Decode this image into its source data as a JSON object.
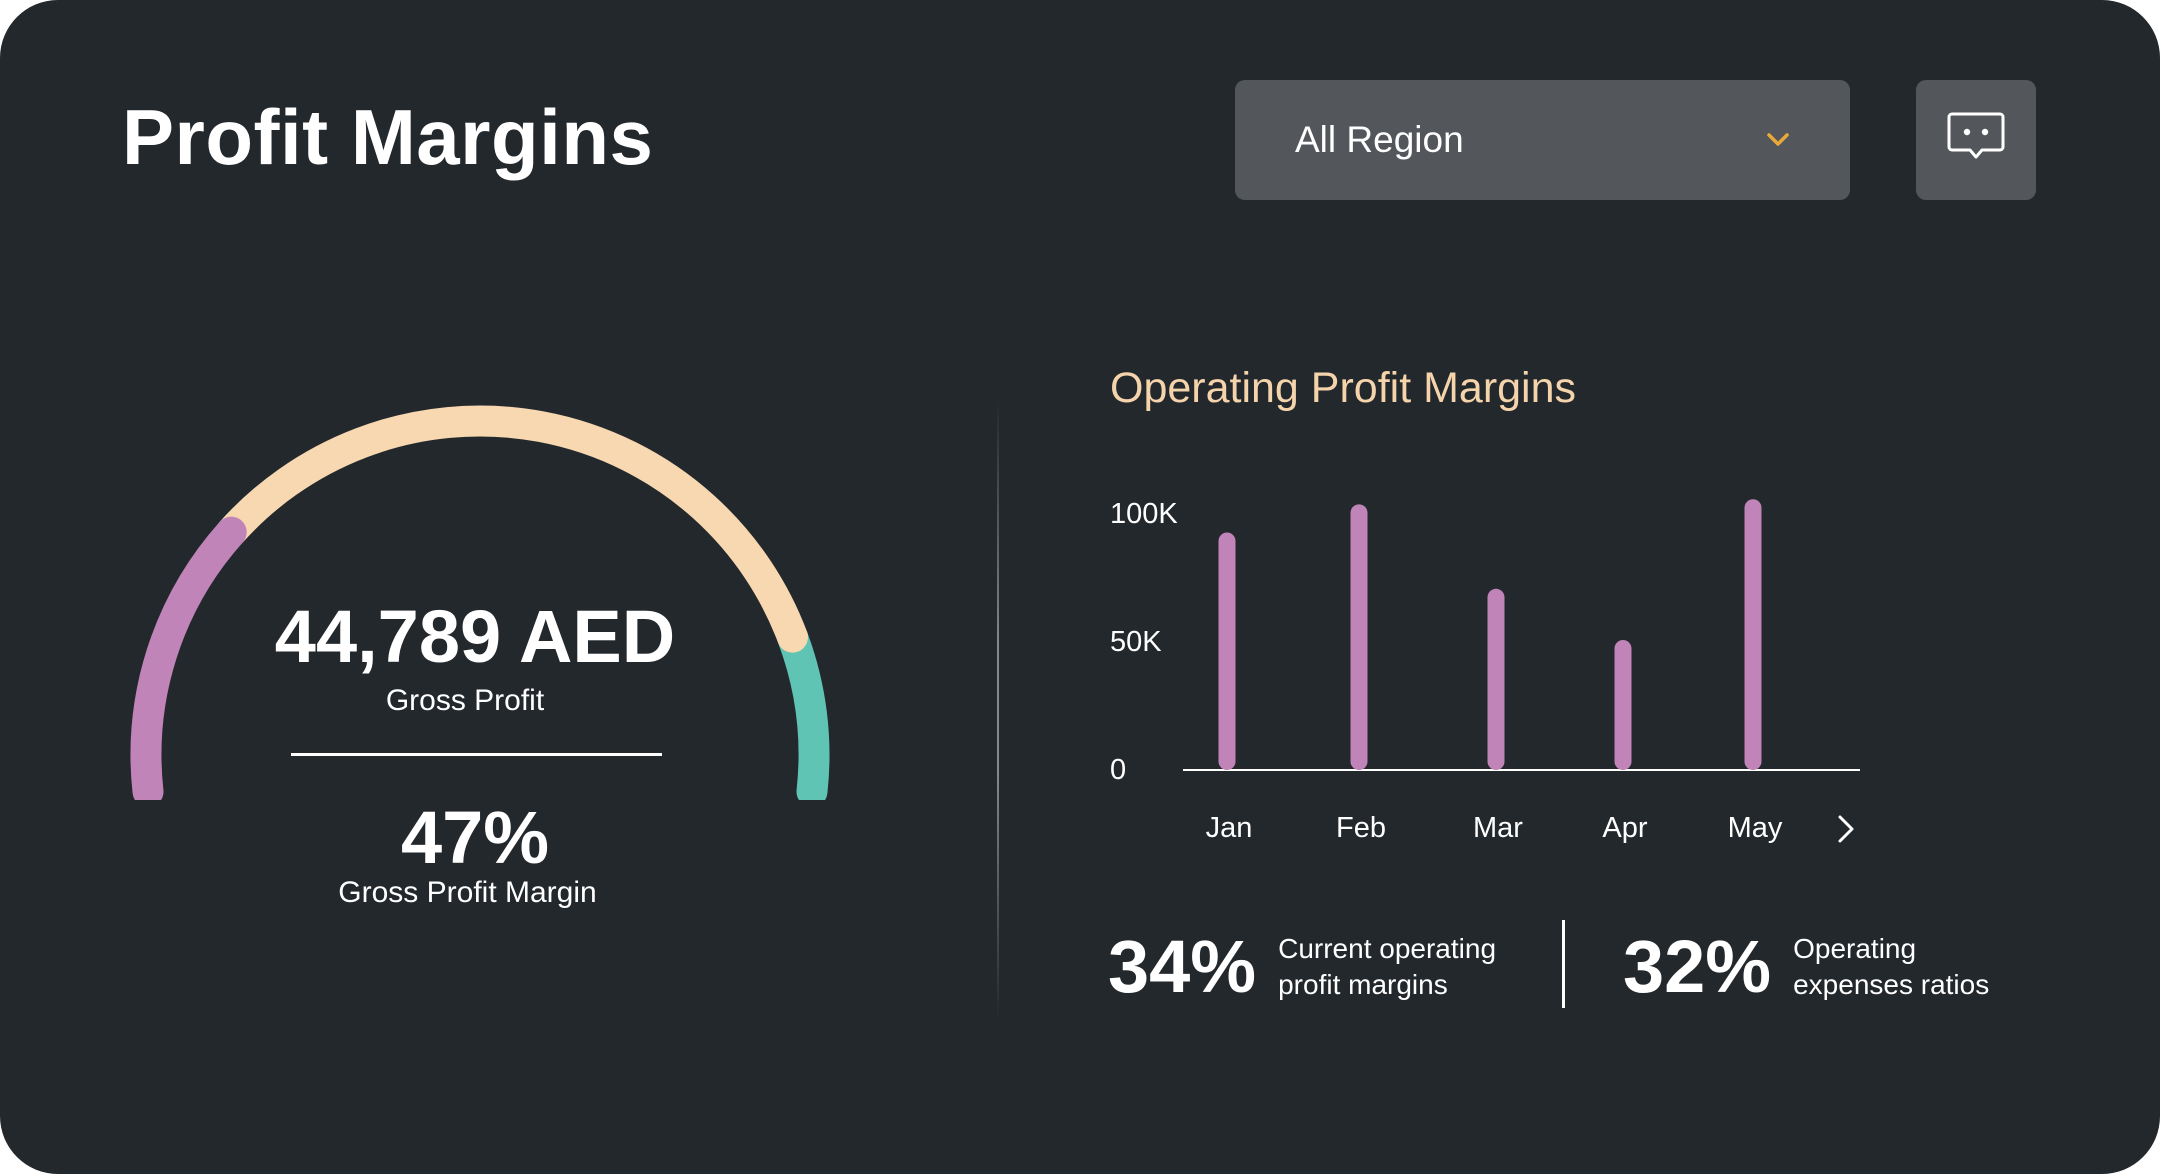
{
  "header": {
    "title": "Profit Margins",
    "region_select": {
      "selected": "All Region",
      "icon": "chevron-down-icon"
    },
    "chat_button": {
      "icon": "chat-bubble-icon"
    }
  },
  "gauge": {
    "gross_profit_value": "44,789 AED",
    "gross_profit_label": "Gross Profit",
    "margin_value": "47%",
    "margin_label": "Gross Profit Margin",
    "segments": [
      {
        "color": "#c084b8",
        "fraction": 0.25
      },
      {
        "color": "#f8d8b0",
        "fraction": 0.61
      },
      {
        "color": "#5fc4b4",
        "fraction": 0.14
      }
    ]
  },
  "operating": {
    "title": "Operating Profit Margins",
    "next_icon": "chevron-right-icon",
    "stats": [
      {
        "value": "34%",
        "label_line1": "Current operating",
        "label_line2": "profit margins"
      },
      {
        "value": "32%",
        "label_line1": "Operating",
        "label_line2": "expenses ratios"
      }
    ]
  },
  "chart_data": {
    "type": "bar",
    "categories": [
      "Jan",
      "Feb",
      "Mar",
      "Apr",
      "May"
    ],
    "values": [
      92,
      103,
      70,
      50,
      105
    ],
    "ylim": [
      0,
      100
    ],
    "yticks": [
      "0",
      "50K",
      "100K"
    ],
    "bar_color": "#c084b8",
    "grid": false
  },
  "colors": {
    "background": "#23282d",
    "accent_chevron": "#e8a93a",
    "chart_title": "#f6d4ab"
  }
}
